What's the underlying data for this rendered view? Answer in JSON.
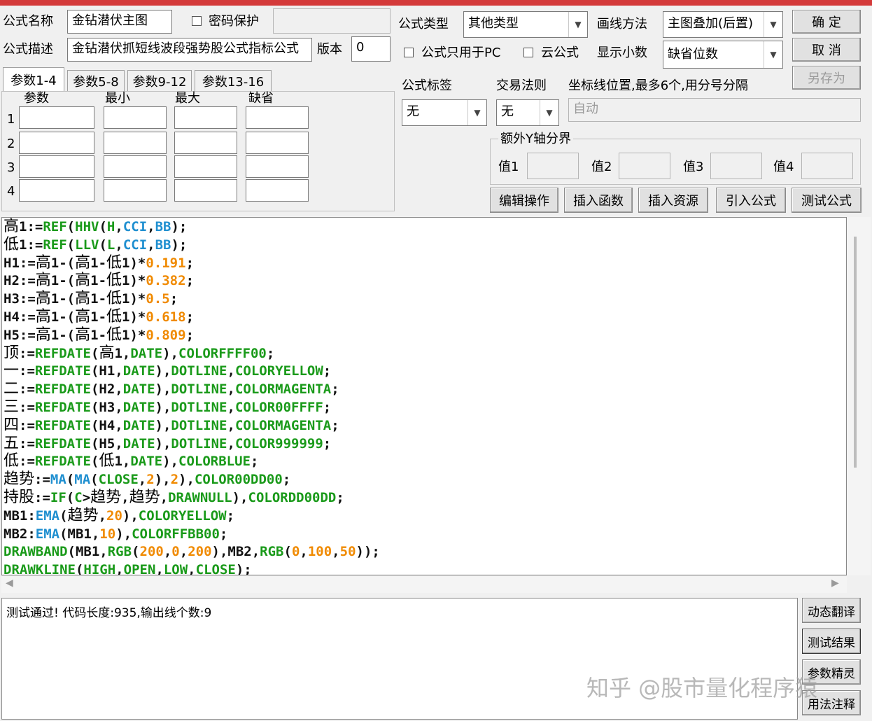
{
  "header": {
    "name_label": "公式名称",
    "name_value": "金钻潜伏主图",
    "password_label": "密码保护",
    "desc_label": "公式描述",
    "desc_value": "金钻潜伏抓短线波段强势股公式指标公式",
    "version_label": "版本",
    "version_value": "0",
    "type_label": "公式类型",
    "type_value": "其他类型",
    "draw_label": "画线方法",
    "draw_value": "主图叠加(后置)",
    "pc_only_label": "公式只用于PC",
    "cloud_label": "云公式",
    "decimals_label": "显示小数",
    "decimals_value": "缺省位数"
  },
  "buttons": {
    "ok": "确  定",
    "cancel": "取  消",
    "save_as": "另存为",
    "edit": "编辑操作",
    "insert_func": "插入函数",
    "insert_res": "插入资源",
    "import": "引入公式",
    "test": "测试公式",
    "dyn_translate": "动态翻译",
    "test_result": "测试结果",
    "param_wizard": "参数精灵",
    "usage": "用法注释"
  },
  "params": {
    "tabs": [
      "参数1-4",
      "参数5-8",
      "参数9-12",
      "参数13-16"
    ],
    "active_tab": 0,
    "headers": [
      "参数",
      "最小",
      "最大",
      "缺省"
    ],
    "rows": [
      "1",
      "2",
      "3",
      "4"
    ]
  },
  "right_panel": {
    "tag_label": "公式标签",
    "tag_value": "无",
    "rule_label": "交易法则",
    "rule_value": "无",
    "axis_label": "坐标线位置,最多6个,用分号分隔",
    "axis_value": "自动",
    "y_group_label": "额外Y轴分界",
    "y_labels": [
      "值1",
      "值2",
      "值3",
      "值4"
    ]
  },
  "code_lines": [
    [
      [
        "高",
        "cjk"
      ],
      [
        "1:=",
        "black"
      ],
      [
        "REF",
        "green"
      ],
      [
        "(",
        "black"
      ],
      [
        "HHV",
        "green"
      ],
      [
        "(",
        "black"
      ],
      [
        "H",
        "green"
      ],
      [
        ",",
        "black"
      ],
      [
        "CCI",
        "blue"
      ],
      [
        ",",
        "black"
      ],
      [
        "BB",
        "blue"
      ],
      [
        ");",
        "black"
      ]
    ],
    [
      [
        "低",
        "cjk"
      ],
      [
        "1:=",
        "black"
      ],
      [
        "REF",
        "green"
      ],
      [
        "(",
        "black"
      ],
      [
        "LLV",
        "green"
      ],
      [
        "(",
        "black"
      ],
      [
        "L",
        "green"
      ],
      [
        ",",
        "black"
      ],
      [
        "CCI",
        "blue"
      ],
      [
        ",",
        "black"
      ],
      [
        "BB",
        "blue"
      ],
      [
        ");",
        "black"
      ]
    ],
    [
      [
        "H1:=",
        "black"
      ],
      [
        "高",
        "cjk"
      ],
      [
        "1-(",
        "black"
      ],
      [
        "高",
        "cjk"
      ],
      [
        "1-",
        "black"
      ],
      [
        "低",
        "cjk"
      ],
      [
        "1)*",
        "black"
      ],
      [
        "0.191",
        "orange"
      ],
      [
        ";",
        "black"
      ]
    ],
    [
      [
        "H2:=",
        "black"
      ],
      [
        "高",
        "cjk"
      ],
      [
        "1-(",
        "black"
      ],
      [
        "高",
        "cjk"
      ],
      [
        "1-",
        "black"
      ],
      [
        "低",
        "cjk"
      ],
      [
        "1)*",
        "black"
      ],
      [
        "0.382",
        "orange"
      ],
      [
        ";",
        "black"
      ]
    ],
    [
      [
        "H3:=",
        "black"
      ],
      [
        "高",
        "cjk"
      ],
      [
        "1-(",
        "black"
      ],
      [
        "高",
        "cjk"
      ],
      [
        "1-",
        "black"
      ],
      [
        "低",
        "cjk"
      ],
      [
        "1)*",
        "black"
      ],
      [
        "0.5",
        "orange"
      ],
      [
        ";",
        "black"
      ]
    ],
    [
      [
        "H4:=",
        "black"
      ],
      [
        "高",
        "cjk"
      ],
      [
        "1-(",
        "black"
      ],
      [
        "高",
        "cjk"
      ],
      [
        "1-",
        "black"
      ],
      [
        "低",
        "cjk"
      ],
      [
        "1)*",
        "black"
      ],
      [
        "0.618",
        "orange"
      ],
      [
        ";",
        "black"
      ]
    ],
    [
      [
        "H5:=",
        "black"
      ],
      [
        "高",
        "cjk"
      ],
      [
        "1-(",
        "black"
      ],
      [
        "高",
        "cjk"
      ],
      [
        "1-",
        "black"
      ],
      [
        "低",
        "cjk"
      ],
      [
        "1)*",
        "black"
      ],
      [
        "0.809",
        "orange"
      ],
      [
        ";",
        "black"
      ]
    ],
    [
      [
        "顶",
        "cjk"
      ],
      [
        ":=",
        "black"
      ],
      [
        "REFDATE",
        "green"
      ],
      [
        "(",
        "black"
      ],
      [
        "高",
        "cjk"
      ],
      [
        "1,",
        "black"
      ],
      [
        "DATE",
        "green"
      ],
      [
        "),",
        "black"
      ],
      [
        "COLORFFFF00",
        "green"
      ],
      [
        ";",
        "black"
      ]
    ],
    [
      [
        "一",
        "cjk"
      ],
      [
        ":=",
        "black"
      ],
      [
        "REFDATE",
        "green"
      ],
      [
        "(H1,",
        "black"
      ],
      [
        "DATE",
        "green"
      ],
      [
        "),",
        "black"
      ],
      [
        "DOTLINE",
        "green"
      ],
      [
        ",",
        "black"
      ],
      [
        "COLORYELLOW",
        "green"
      ],
      [
        ";",
        "black"
      ]
    ],
    [
      [
        "二",
        "cjk"
      ],
      [
        ":=",
        "black"
      ],
      [
        "REFDATE",
        "green"
      ],
      [
        "(H2,",
        "black"
      ],
      [
        "DATE",
        "green"
      ],
      [
        "),",
        "black"
      ],
      [
        "DOTLINE",
        "green"
      ],
      [
        ",",
        "black"
      ],
      [
        "COLORMAGENTA",
        "green"
      ],
      [
        ";",
        "black"
      ]
    ],
    [
      [
        "三",
        "cjk"
      ],
      [
        ":=",
        "black"
      ],
      [
        "REFDATE",
        "green"
      ],
      [
        "(H3,",
        "black"
      ],
      [
        "DATE",
        "green"
      ],
      [
        "),",
        "black"
      ],
      [
        "DOTLINE",
        "green"
      ],
      [
        ",",
        "black"
      ],
      [
        "COLOR00FFFF",
        "green"
      ],
      [
        ";",
        "black"
      ]
    ],
    [
      [
        "四",
        "cjk"
      ],
      [
        ":=",
        "black"
      ],
      [
        "REFDATE",
        "green"
      ],
      [
        "(H4,",
        "black"
      ],
      [
        "DATE",
        "green"
      ],
      [
        "),",
        "black"
      ],
      [
        "DOTLINE",
        "green"
      ],
      [
        ",",
        "black"
      ],
      [
        "COLORMAGENTA",
        "green"
      ],
      [
        ";",
        "black"
      ]
    ],
    [
      [
        "五",
        "cjk"
      ],
      [
        ":=",
        "black"
      ],
      [
        "REFDATE",
        "green"
      ],
      [
        "(H5,",
        "black"
      ],
      [
        "DATE",
        "green"
      ],
      [
        "),",
        "black"
      ],
      [
        "DOTLINE",
        "green"
      ],
      [
        ",",
        "black"
      ],
      [
        "COLOR999999",
        "green"
      ],
      [
        ";",
        "black"
      ]
    ],
    [
      [
        "低",
        "cjk"
      ],
      [
        ":=",
        "black"
      ],
      [
        "REFDATE",
        "green"
      ],
      [
        "(",
        "black"
      ],
      [
        "低",
        "cjk"
      ],
      [
        "1,",
        "black"
      ],
      [
        "DATE",
        "green"
      ],
      [
        "),",
        "black"
      ],
      [
        "COLORBLUE",
        "green"
      ],
      [
        ";",
        "black"
      ]
    ],
    [
      [
        "趋势",
        "cjk"
      ],
      [
        ":=",
        "black"
      ],
      [
        "MA",
        "blue"
      ],
      [
        "(",
        "black"
      ],
      [
        "MA",
        "blue"
      ],
      [
        "(",
        "black"
      ],
      [
        "CLOSE",
        "green"
      ],
      [
        ",",
        "black"
      ],
      [
        "2",
        "orange"
      ],
      [
        "),",
        "black"
      ],
      [
        "2",
        "orange"
      ],
      [
        "),",
        "black"
      ],
      [
        "COLOR00DD00",
        "green"
      ],
      [
        ";",
        "black"
      ]
    ],
    [
      [
        "持股",
        "cjk"
      ],
      [
        ":=",
        "black"
      ],
      [
        "IF",
        "green"
      ],
      [
        "(",
        "black"
      ],
      [
        "C",
        "green"
      ],
      [
        ">",
        "black"
      ],
      [
        "趋势",
        "cjk"
      ],
      [
        ",",
        "black"
      ],
      [
        "趋势",
        "cjk"
      ],
      [
        ",",
        "black"
      ],
      [
        "DRAWNULL",
        "green"
      ],
      [
        "),",
        "black"
      ],
      [
        "COLORDD00DD",
        "green"
      ],
      [
        ";",
        "black"
      ]
    ],
    [
      [
        "MB1:",
        "black"
      ],
      [
        "EMA",
        "blue"
      ],
      [
        "(",
        "black"
      ],
      [
        "趋势",
        "cjk"
      ],
      [
        ",",
        "black"
      ],
      [
        "20",
        "orange"
      ],
      [
        "),",
        "black"
      ],
      [
        "COLORYELLOW",
        "green"
      ],
      [
        ";",
        "black"
      ]
    ],
    [
      [
        "MB2:",
        "black"
      ],
      [
        "EMA",
        "blue"
      ],
      [
        "(MB1,",
        "black"
      ],
      [
        "10",
        "orange"
      ],
      [
        "),",
        "black"
      ],
      [
        "COLORFFBB00",
        "green"
      ],
      [
        ";",
        "black"
      ]
    ],
    [
      [
        "DRAWBAND",
        "green"
      ],
      [
        "(MB1,",
        "black"
      ],
      [
        "RGB",
        "green"
      ],
      [
        "(",
        "black"
      ],
      [
        "200",
        "orange"
      ],
      [
        ",",
        "black"
      ],
      [
        "0",
        "orange"
      ],
      [
        ",",
        "black"
      ],
      [
        "200",
        "orange"
      ],
      [
        "),MB2,",
        "black"
      ],
      [
        "RGB",
        "green"
      ],
      [
        "(",
        "black"
      ],
      [
        "0",
        "orange"
      ],
      [
        ",",
        "black"
      ],
      [
        "100",
        "orange"
      ],
      [
        ",",
        "black"
      ],
      [
        "50",
        "orange"
      ],
      [
        "));",
        "black"
      ]
    ],
    [
      [
        "DRAWKLINE",
        "green"
      ],
      [
        "(",
        "black"
      ],
      [
        "HIGH",
        "green"
      ],
      [
        ",",
        "black"
      ],
      [
        "OPEN",
        "green"
      ],
      [
        ",",
        "black"
      ],
      [
        "LOW",
        "green"
      ],
      [
        ",",
        "black"
      ],
      [
        "CLOSE",
        "green"
      ],
      [
        ");",
        "black"
      ]
    ]
  ],
  "result_text": "测试通过! 代码长度:935,输出线个数:9",
  "watermark": "知乎 @股市量化程序猿"
}
